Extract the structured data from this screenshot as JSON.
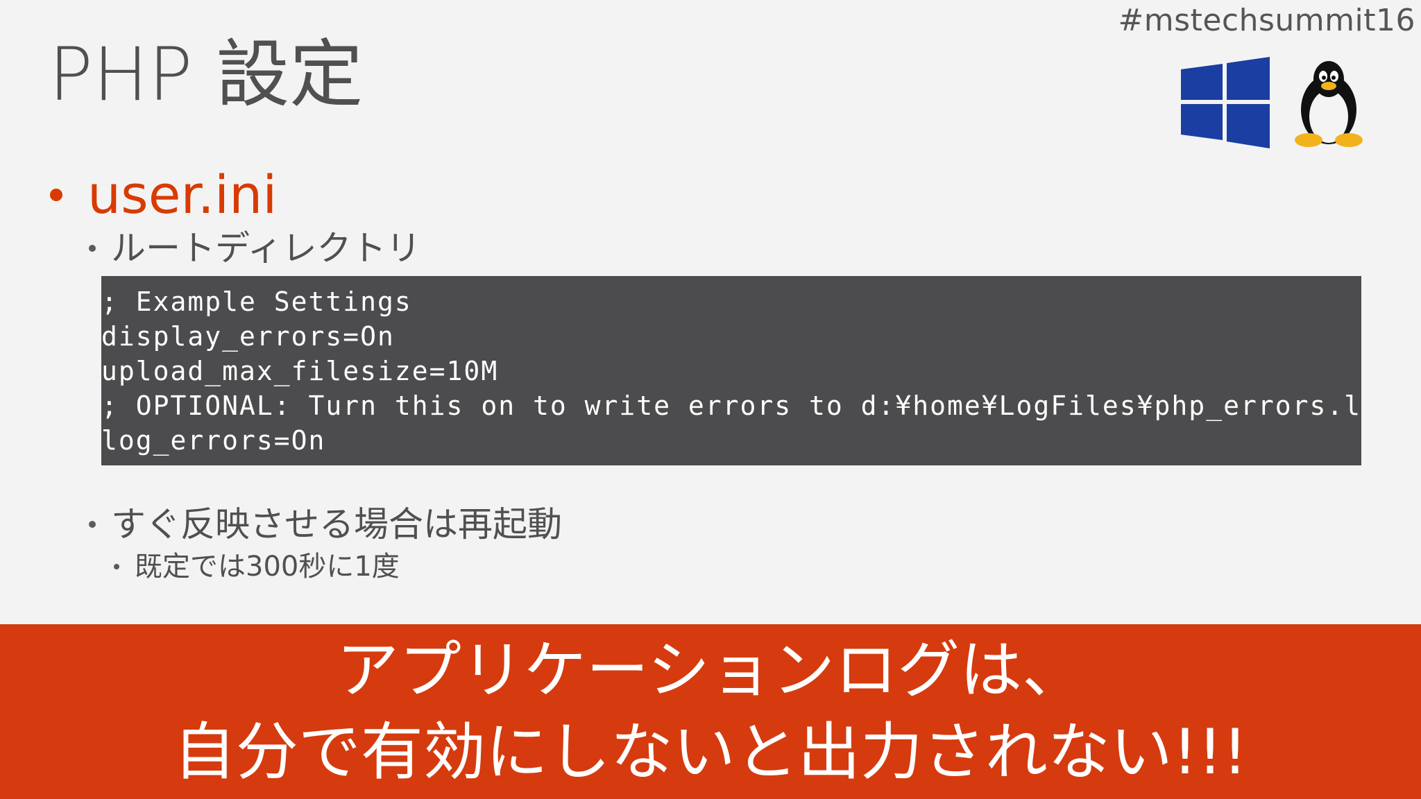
{
  "header": {
    "hashtag": "#mstechsummit16",
    "title": "PHP 設定"
  },
  "icons": {
    "windows_logo": "windows-logo-icon",
    "linux_logo": "tux-penguin-icon"
  },
  "content": {
    "level1": "user.ini",
    "root_dir_label": "ルートディレクトリ",
    "code_lines": [
      "; Example Settings",
      "display_errors=On",
      "upload_max_filesize=10M",
      "; OPTIONAL: Turn this on to write errors to d:¥home¥LogFiles¥php_errors.log",
      "log_errors=On"
    ],
    "restart_label": "すぐ反映させる場合は再起動",
    "default_note": "既定では300秒に1度"
  },
  "banner": {
    "line1": "アプリケーションログは、",
    "line2": "自分で有効にしないと出力されない!!!"
  },
  "colors": {
    "accent": "#d83b01",
    "banner_bg": "#d53b0e",
    "code_bg": "#4c4c4e",
    "windows_blue": "#1a3ea1",
    "background": "#f3f3f3"
  }
}
